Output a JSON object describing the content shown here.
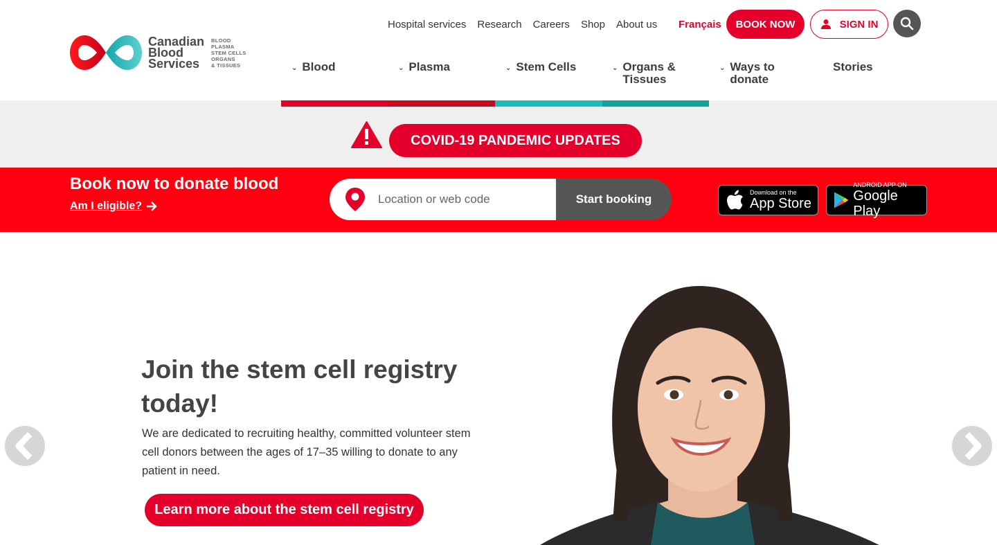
{
  "brand": {
    "name_lines": [
      "Canadian",
      "Blood",
      "Services"
    ],
    "sub_lines": [
      "BLOOD",
      "PLASMA",
      "STEM CELLS",
      "ORGANS",
      "& TISSUES"
    ],
    "colors": {
      "red": "#e4002b",
      "teal": "#1eb2b4",
      "grey": "#555555"
    }
  },
  "utility_nav": {
    "items": [
      "Hospital services",
      "Research",
      "Careers",
      "Shop",
      "About us"
    ],
    "language": "Français",
    "book_now": "BOOK NOW",
    "sign_in": "SIGN IN",
    "search_icon": "search-icon"
  },
  "main_nav": {
    "items": [
      {
        "label": "Blood",
        "has_dropdown": true
      },
      {
        "label": "Plasma",
        "has_dropdown": true
      },
      {
        "label": "Stem Cells",
        "has_dropdown": true
      },
      {
        "label": "Organs &\nTissues",
        "has_dropdown": true
      },
      {
        "label": "Ways to\ndonate",
        "has_dropdown": true
      },
      {
        "label": "Stories",
        "has_dropdown": false
      }
    ]
  },
  "covid": {
    "warning_icon": "warning-icon",
    "button": "COVID-19 PANDEMIC UPDATES"
  },
  "booking": {
    "title": "Book now to donate blood",
    "eligible_link": "Am I eligible?",
    "search_placeholder": "Location or web code",
    "start_button": "Start booking",
    "app_store": {
      "small": "Download on the",
      "big": "App Store"
    },
    "google_play": {
      "small": "ANDROID APP ON",
      "big": "Google Play"
    }
  },
  "hero": {
    "title": "Join the stem cell registry today!",
    "text": "We are dedicated to recruiting healthy, committed volunteer stem cell donors between the ages of 17–35 willing to donate to any patient in need.",
    "button": "Learn more about the stem cell registry",
    "prev_icon": "chevron-left-icon",
    "next_icon": "chevron-right-icon"
  }
}
